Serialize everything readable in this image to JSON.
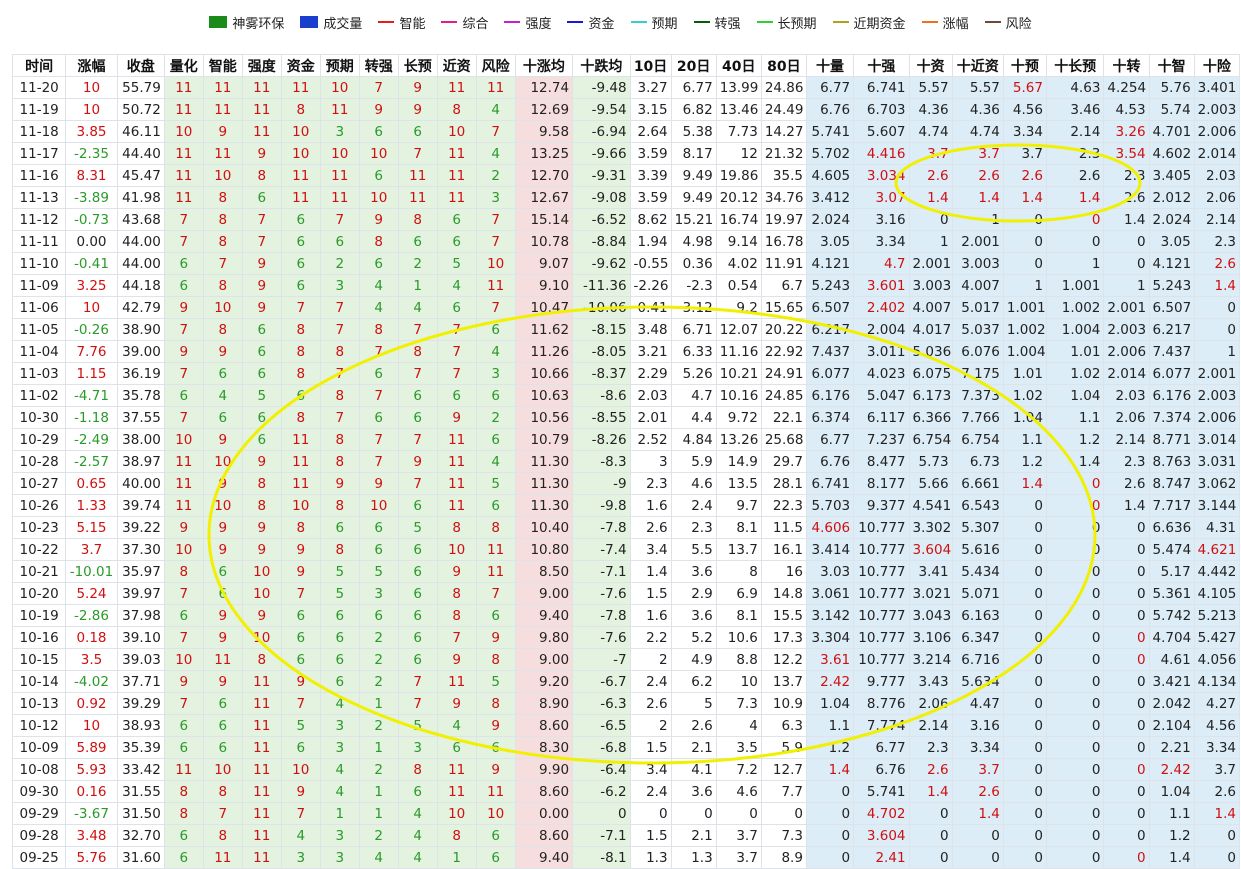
{
  "legend": [
    {
      "label": "神雾环保",
      "kind": "box",
      "color": "#1a8a1a"
    },
    {
      "label": "成交量",
      "kind": "box",
      "color": "#1a3fcc"
    },
    {
      "label": "智能",
      "kind": "line",
      "color": "#e02020"
    },
    {
      "label": "综合",
      "kind": "line",
      "color": "#e0208a"
    },
    {
      "label": "强度",
      "kind": "line",
      "color": "#c020d0"
    },
    {
      "label": "资金",
      "kind": "line",
      "color": "#1a1acc"
    },
    {
      "label": "预期",
      "kind": "line",
      "color": "#30d0d0"
    },
    {
      "label": "转强",
      "kind": "line",
      "color": "#0a5a0a"
    },
    {
      "label": "长预期",
      "kind": "line",
      "color": "#30d030"
    },
    {
      "label": "近期资金",
      "kind": "line",
      "color": "#b0a020"
    },
    {
      "label": "涨幅",
      "kind": "line",
      "color": "#f07020"
    },
    {
      "label": "风险",
      "kind": "line",
      "color": "#6a4a3a"
    }
  ],
  "colors": {
    "green_bg": "#e4f2e0",
    "pink_bg": "#f7dede",
    "blue_bg": "#dcedf7",
    "up": "#d01010",
    "down": "#2a9a2a",
    "highlight": "#f0f000"
  },
  "chart_data": {
    "type": "table",
    "columns": [
      "时间",
      "涨幅",
      "收盘",
      "量化",
      "智能",
      "强度",
      "资金",
      "预期",
      "转强",
      "长预",
      "近资",
      "风险",
      "十涨均",
      "十跌均",
      "10日",
      "20日",
      "40日",
      "80日",
      "十量",
      "十强",
      "十资",
      "十近资",
      "十预",
      "十长预",
      "十转",
      "十智",
      "十险"
    ],
    "rows": [
      [
        "11-20",
        "10",
        "55.79",
        "11",
        "11",
        "11",
        "11",
        "10",
        "7",
        "9",
        "11",
        "11",
        "12.74",
        "-9.48",
        "3.27",
        "6.77",
        "13.99",
        "24.86",
        "6.77",
        "6.741",
        "5.57",
        "5.57",
        "5.67",
        "4.63",
        "4.254",
        "5.76",
        "3.401"
      ],
      [
        "11-19",
        "10",
        "50.72",
        "11",
        "11",
        "11",
        "8",
        "11",
        "9",
        "9",
        "8",
        "4",
        "12.69",
        "-9.54",
        "3.15",
        "6.82",
        "13.46",
        "24.49",
        "6.76",
        "6.703",
        "4.36",
        "4.36",
        "4.56",
        "3.46",
        "4.53",
        "5.74",
        "2.003"
      ],
      [
        "11-18",
        "3.85",
        "46.11",
        "10",
        "9",
        "11",
        "10",
        "3",
        "6",
        "6",
        "10",
        "7",
        "9.58",
        "-6.94",
        "2.64",
        "5.38",
        "7.73",
        "14.27",
        "5.741",
        "5.607",
        "4.74",
        "4.74",
        "3.34",
        "2.14",
        "3.26",
        "4.701",
        "2.006"
      ],
      [
        "11-17",
        "-2.35",
        "44.40",
        "11",
        "11",
        "9",
        "10",
        "10",
        "10",
        "7",
        "11",
        "4",
        "13.25",
        "-9.66",
        "3.59",
        "8.17",
        "12",
        "21.32",
        "5.702",
        "4.416",
        "3.7",
        "3.7",
        "3.7",
        "2.3",
        "3.54",
        "4.602",
        "2.014"
      ],
      [
        "11-16",
        "8.31",
        "45.47",
        "11",
        "10",
        "8",
        "11",
        "11",
        "6",
        "11",
        "11",
        "2",
        "12.70",
        "-9.31",
        "3.39",
        "9.49",
        "19.86",
        "35.5",
        "4.605",
        "3.034",
        "2.6",
        "2.6",
        "2.6",
        "2.6",
        "2.3",
        "3.405",
        "2.03"
      ],
      [
        "11-13",
        "-3.89",
        "41.98",
        "11",
        "8",
        "6",
        "11",
        "11",
        "10",
        "11",
        "11",
        "3",
        "12.67",
        "-9.08",
        "3.59",
        "9.49",
        "20.12",
        "34.76",
        "3.412",
        "3.07",
        "1.4",
        "1.4",
        "1.4",
        "1.4",
        "2.6",
        "2.012",
        "2.06"
      ],
      [
        "11-12",
        "-0.73",
        "43.68",
        "7",
        "8",
        "7",
        "6",
        "7",
        "9",
        "8",
        "6",
        "7",
        "15.14",
        "-6.52",
        "8.62",
        "15.21",
        "16.74",
        "19.97",
        "2.024",
        "3.16",
        "0",
        "1",
        "0",
        "0",
        "1.4",
        "2.024",
        "2.14"
      ],
      [
        "11-11",
        "0.00",
        "44.00",
        "7",
        "8",
        "7",
        "6",
        "6",
        "8",
        "6",
        "6",
        "7",
        "10.78",
        "-8.84",
        "1.94",
        "4.98",
        "9.14",
        "16.78",
        "3.05",
        "3.34",
        "1",
        "2.001",
        "0",
        "0",
        "0",
        "3.05",
        "2.3"
      ],
      [
        "11-10",
        "-0.41",
        "44.00",
        "6",
        "7",
        "9",
        "6",
        "2",
        "6",
        "2",
        "5",
        "10",
        "9.07",
        "-9.62",
        "-0.55",
        "0.36",
        "4.02",
        "11.91",
        "4.121",
        "4.7",
        "2.001",
        "3.003",
        "0",
        "1",
        "0",
        "4.121",
        "2.6"
      ],
      [
        "11-09",
        "3.25",
        "44.18",
        "6",
        "8",
        "9",
        "6",
        "3",
        "4",
        "1",
        "4",
        "11",
        "9.10",
        "-11.36",
        "-2.26",
        "-2.3",
        "0.54",
        "6.7",
        "5.243",
        "3.601",
        "3.003",
        "4.007",
        "1",
        "1.001",
        "1",
        "5.243",
        "1.4"
      ],
      [
        "11-06",
        "10",
        "42.79",
        "9",
        "10",
        "9",
        "7",
        "7",
        "4",
        "4",
        "6",
        "7",
        "10.47",
        "-10.06",
        "0.41",
        "3.12",
        "9.2",
        "15.65",
        "6.507",
        "2.402",
        "4.007",
        "5.017",
        "1.001",
        "1.002",
        "2.001",
        "6.507",
        "0"
      ],
      [
        "11-05",
        "-0.26",
        "38.90",
        "7",
        "8",
        "6",
        "8",
        "7",
        "8",
        "7",
        "7",
        "6",
        "11.62",
        "-8.15",
        "3.48",
        "6.71",
        "12.07",
        "20.22",
        "6.217",
        "2.004",
        "4.017",
        "5.037",
        "1.002",
        "1.004",
        "2.003",
        "6.217",
        "0"
      ],
      [
        "11-04",
        "7.76",
        "39.00",
        "9",
        "9",
        "6",
        "8",
        "8",
        "7",
        "8",
        "7",
        "4",
        "11.26",
        "-8.05",
        "3.21",
        "6.33",
        "11.16",
        "22.92",
        "7.437",
        "3.011",
        "5.036",
        "6.076",
        "1.004",
        "1.01",
        "2.006",
        "7.437",
        "1"
      ],
      [
        "11-03",
        "1.15",
        "36.19",
        "7",
        "6",
        "6",
        "8",
        "7",
        "6",
        "7",
        "7",
        "3",
        "10.66",
        "-8.37",
        "2.29",
        "5.26",
        "10.21",
        "24.91",
        "6.077",
        "4.023",
        "6.075",
        "7.175",
        "1.01",
        "1.02",
        "2.014",
        "6.077",
        "2.001"
      ],
      [
        "11-02",
        "-4.71",
        "35.78",
        "6",
        "4",
        "5",
        "6",
        "8",
        "7",
        "6",
        "6",
        "6",
        "10.63",
        "-8.6",
        "2.03",
        "4.7",
        "10.16",
        "24.85",
        "6.176",
        "5.047",
        "6.173",
        "7.373",
        "1.02",
        "1.04",
        "2.03",
        "6.176",
        "2.003"
      ],
      [
        "10-30",
        "-1.18",
        "37.55",
        "7",
        "6",
        "6",
        "8",
        "7",
        "6",
        "6",
        "9",
        "2",
        "10.56",
        "-8.55",
        "2.01",
        "4.4",
        "9.72",
        "22.1",
        "6.374",
        "6.117",
        "6.366",
        "7.766",
        "1.04",
        "1.1",
        "2.06",
        "7.374",
        "2.006"
      ],
      [
        "10-29",
        "-2.49",
        "38.00",
        "10",
        "9",
        "6",
        "11",
        "8",
        "7",
        "7",
        "11",
        "6",
        "10.79",
        "-8.26",
        "2.52",
        "4.84",
        "13.26",
        "25.68",
        "6.77",
        "7.237",
        "6.754",
        "6.754",
        "1.1",
        "1.2",
        "2.14",
        "8.771",
        "3.014"
      ],
      [
        "10-28",
        "-2.57",
        "38.97",
        "11",
        "10",
        "9",
        "11",
        "8",
        "7",
        "9",
        "11",
        "4",
        "11.30",
        "-8.3",
        "3",
        "5.9",
        "14.9",
        "29.7",
        "6.76",
        "8.477",
        "5.73",
        "6.73",
        "1.2",
        "1.4",
        "2.3",
        "8.763",
        "3.031"
      ],
      [
        "10-27",
        "0.65",
        "40.00",
        "11",
        "9",
        "8",
        "11",
        "9",
        "9",
        "7",
        "11",
        "5",
        "11.30",
        "-9",
        "2.3",
        "4.6",
        "13.5",
        "28.1",
        "6.741",
        "8.177",
        "5.66",
        "6.661",
        "1.4",
        "0",
        "2.6",
        "8.747",
        "3.062"
      ],
      [
        "10-26",
        "1.33",
        "39.74",
        "11",
        "10",
        "8",
        "10",
        "8",
        "10",
        "6",
        "11",
        "6",
        "11.30",
        "-9.8",
        "1.6",
        "2.4",
        "9.7",
        "22.3",
        "5.703",
        "9.377",
        "4.541",
        "6.543",
        "0",
        "0",
        "1.4",
        "7.717",
        "3.144"
      ],
      [
        "10-23",
        "5.15",
        "39.22",
        "9",
        "9",
        "9",
        "8",
        "6",
        "6",
        "5",
        "8",
        "8",
        "10.40",
        "-7.8",
        "2.6",
        "2.3",
        "8.1",
        "11.5",
        "4.606",
        "10.777",
        "3.302",
        "5.307",
        "0",
        "0",
        "0",
        "6.636",
        "4.31"
      ],
      [
        "10-22",
        "3.7",
        "37.30",
        "10",
        "9",
        "9",
        "9",
        "8",
        "6",
        "6",
        "10",
        "11",
        "10.80",
        "-7.4",
        "3.4",
        "5.5",
        "13.7",
        "16.1",
        "3.414",
        "10.777",
        "3.604",
        "5.616",
        "0",
        "0",
        "0",
        "5.474",
        "4.621"
      ],
      [
        "10-21",
        "-10.01",
        "35.97",
        "8",
        "6",
        "10",
        "9",
        "5",
        "5",
        "6",
        "9",
        "11",
        "8.50",
        "-7.1",
        "1.4",
        "3.6",
        "8",
        "16",
        "3.03",
        "10.777",
        "3.41",
        "5.434",
        "0",
        "0",
        "0",
        "5.17",
        "4.442"
      ],
      [
        "10-20",
        "5.24",
        "39.97",
        "7",
        "6",
        "10",
        "7",
        "5",
        "3",
        "6",
        "8",
        "7",
        "9.00",
        "-7.6",
        "1.5",
        "2.9",
        "6.9",
        "14.8",
        "3.061",
        "10.777",
        "3.021",
        "5.071",
        "0",
        "0",
        "0",
        "5.361",
        "4.105"
      ],
      [
        "10-19",
        "-2.86",
        "37.98",
        "6",
        "9",
        "9",
        "6",
        "6",
        "6",
        "6",
        "8",
        "6",
        "9.40",
        "-7.8",
        "1.6",
        "3.6",
        "8.1",
        "15.5",
        "3.142",
        "10.777",
        "3.043",
        "6.163",
        "0",
        "0",
        "0",
        "5.742",
        "5.213"
      ],
      [
        "10-16",
        "0.18",
        "39.10",
        "7",
        "9",
        "10",
        "6",
        "6",
        "2",
        "6",
        "7",
        "9",
        "9.80",
        "-7.6",
        "2.2",
        "5.2",
        "10.6",
        "17.3",
        "3.304",
        "10.777",
        "3.106",
        "6.347",
        "0",
        "0",
        "0",
        "4.704",
        "5.427"
      ],
      [
        "10-15",
        "3.5",
        "39.03",
        "10",
        "11",
        "8",
        "6",
        "6",
        "2",
        "6",
        "9",
        "8",
        "9.00",
        "-7",
        "2",
        "4.9",
        "8.8",
        "12.2",
        "3.61",
        "10.777",
        "3.214",
        "6.716",
        "0",
        "0",
        "0",
        "4.61",
        "4.056"
      ],
      [
        "10-14",
        "-4.02",
        "37.71",
        "9",
        "9",
        "11",
        "9",
        "6",
        "2",
        "7",
        "11",
        "5",
        "9.20",
        "-6.7",
        "2.4",
        "6.2",
        "10",
        "13.7",
        "2.42",
        "9.777",
        "3.43",
        "5.634",
        "0",
        "0",
        "0",
        "3.421",
        "4.134"
      ],
      [
        "10-13",
        "0.92",
        "39.29",
        "7",
        "6",
        "11",
        "7",
        "4",
        "1",
        "7",
        "9",
        "8",
        "8.90",
        "-6.3",
        "2.6",
        "5",
        "7.3",
        "10.9",
        "1.04",
        "8.776",
        "2.06",
        "4.47",
        "0",
        "0",
        "0",
        "2.042",
        "4.27"
      ],
      [
        "10-12",
        "10",
        "38.93",
        "6",
        "6",
        "11",
        "5",
        "3",
        "2",
        "5",
        "4",
        "9",
        "8.60",
        "-6.5",
        "2",
        "2.6",
        "4",
        "6.3",
        "1.1",
        "7.774",
        "2.14",
        "3.16",
        "0",
        "0",
        "0",
        "2.104",
        "4.56"
      ],
      [
        "10-09",
        "5.89",
        "35.39",
        "6",
        "6",
        "11",
        "6",
        "3",
        "1",
        "3",
        "6",
        "6",
        "8.30",
        "-6.8",
        "1.5",
        "2.1",
        "3.5",
        "5.9",
        "1.2",
        "6.77",
        "2.3",
        "3.34",
        "0",
        "0",
        "0",
        "2.21",
        "3.34"
      ],
      [
        "10-08",
        "5.93",
        "33.42",
        "11",
        "10",
        "11",
        "10",
        "4",
        "2",
        "8",
        "11",
        "9",
        "9.90",
        "-6.4",
        "3.4",
        "4.1",
        "7.2",
        "12.7",
        "1.4",
        "6.76",
        "2.6",
        "3.7",
        "0",
        "0",
        "0",
        "2.42",
        "3.7"
      ],
      [
        "09-30",
        "0.16",
        "31.55",
        "8",
        "8",
        "11",
        "9",
        "4",
        "1",
        "6",
        "11",
        "11",
        "8.60",
        "-6.2",
        "2.4",
        "3.6",
        "4.6",
        "7.7",
        "0",
        "5.741",
        "1.4",
        "2.6",
        "0",
        "0",
        "0",
        "1.04",
        "2.6"
      ],
      [
        "09-29",
        "-3.67",
        "31.50",
        "8",
        "7",
        "11",
        "7",
        "1",
        "1",
        "4",
        "10",
        "10",
        "0.00",
        "0",
        "0",
        "0",
        "0",
        "0",
        "0",
        "4.702",
        "0",
        "1.4",
        "0",
        "0",
        "0",
        "1.1",
        "1.4"
      ],
      [
        "09-28",
        "3.48",
        "32.70",
        "6",
        "8",
        "11",
        "4",
        "3",
        "2",
        "4",
        "8",
        "6",
        "8.60",
        "-7.1",
        "1.5",
        "2.1",
        "3.7",
        "7.3",
        "0",
        "3.604",
        "0",
        "0",
        "0",
        "0",
        "0",
        "1.2",
        "0"
      ],
      [
        "09-25",
        "5.76",
        "31.60",
        "6",
        "11",
        "11",
        "3",
        "3",
        "4",
        "4",
        "1",
        "6",
        "9.40",
        "-8.1",
        "1.3",
        "1.3",
        "3.7",
        "8.9",
        "0",
        "2.41",
        "0",
        "0",
        "0",
        "0",
        "0",
        "1.4",
        "0"
      ]
    ],
    "red_cells": [
      [
        0,
        22
      ],
      [
        0,
        1
      ],
      [
        1,
        1
      ],
      [
        2,
        1
      ],
      [
        2,
        24
      ],
      [
        3,
        19
      ],
      [
        3,
        20
      ],
      [
        3,
        21
      ],
      [
        3,
        24
      ],
      [
        4,
        1
      ],
      [
        4,
        19
      ],
      [
        4,
        20
      ],
      [
        4,
        21
      ],
      [
        4,
        22
      ],
      [
        5,
        19
      ],
      [
        5,
        20
      ],
      [
        5,
        21
      ],
      [
        5,
        22
      ],
      [
        5,
        23
      ],
      [
        6,
        23
      ],
      [
        8,
        8
      ],
      [
        8,
        19
      ],
      [
        8,
        26
      ],
      [
        9,
        1
      ],
      [
        9,
        19
      ],
      [
        9,
        26
      ],
      [
        10,
        1
      ],
      [
        10,
        19
      ],
      [
        12,
        1
      ],
      [
        13,
        1
      ],
      [
        18,
        1
      ],
      [
        18,
        22
      ],
      [
        18,
        23
      ],
      [
        19,
        1
      ],
      [
        19,
        23
      ],
      [
        20,
        1
      ],
      [
        20,
        18
      ],
      [
        21,
        1
      ],
      [
        21,
        20
      ],
      [
        21,
        26
      ],
      [
        23,
        1
      ],
      [
        25,
        1
      ],
      [
        25,
        24
      ],
      [
        26,
        1
      ],
      [
        26,
        18
      ],
      [
        26,
        24
      ],
      [
        27,
        18
      ],
      [
        28,
        1
      ],
      [
        29,
        1
      ],
      [
        30,
        1
      ],
      [
        31,
        1
      ],
      [
        31,
        18
      ],
      [
        31,
        20
      ],
      [
        31,
        21
      ],
      [
        31,
        24
      ],
      [
        31,
        25
      ],
      [
        32,
        1
      ],
      [
        32,
        20
      ],
      [
        32,
        21
      ],
      [
        33,
        19
      ],
      [
        33,
        21
      ],
      [
        33,
        26
      ],
      [
        34,
        1
      ],
      [
        34,
        19
      ],
      [
        35,
        1
      ],
      [
        35,
        19
      ],
      [
        35,
        24
      ]
    ]
  }
}
